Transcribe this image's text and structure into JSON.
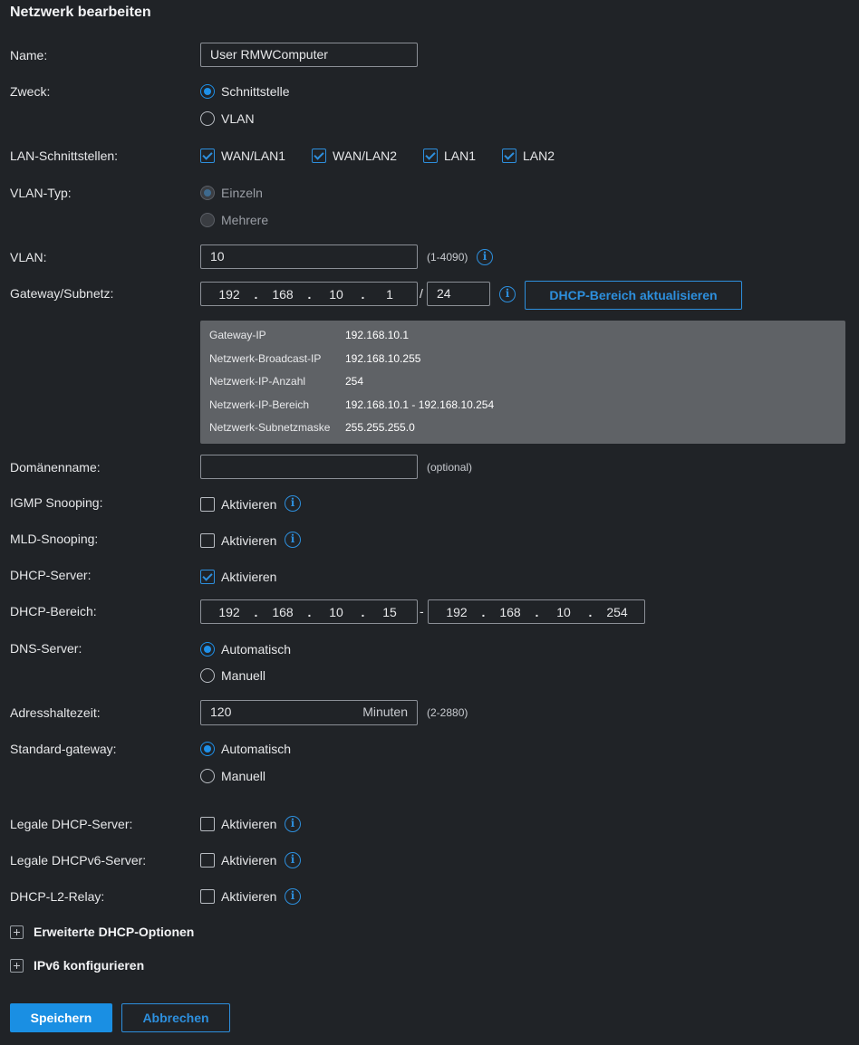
{
  "title": "Netzwerk bearbeiten",
  "name": {
    "label": "Name:",
    "value": "User RMWComputer"
  },
  "zweck": {
    "label": "Zweck:",
    "options": [
      "Schnittstelle",
      "VLAN"
    ],
    "selected": "Schnittstelle"
  },
  "lan_interfaces": {
    "label": "LAN-Schnittstellen:",
    "items": [
      {
        "label": "WAN/LAN1",
        "checked": true
      },
      {
        "label": "WAN/LAN2",
        "checked": true
      },
      {
        "label": "LAN1",
        "checked": true
      },
      {
        "label": "LAN2",
        "checked": true
      }
    ]
  },
  "vlan_type": {
    "label": "VLAN-Typ:",
    "options": [
      "Einzeln",
      "Mehrere"
    ],
    "selected": "Einzeln",
    "disabled": true
  },
  "vlan": {
    "label": "VLAN:",
    "value": "10",
    "range_hint": "(1-4090)"
  },
  "gateway": {
    "label": "Gateway/Subnetz:",
    "octets": [
      "192",
      "168",
      "10",
      "1"
    ],
    "separator": "/",
    "prefix": "24",
    "update_button": "DHCP-Bereich aktualisieren"
  },
  "network_info": [
    {
      "key": "Gateway-IP",
      "value": "192.168.10.1"
    },
    {
      "key": "Netzwerk-Broadcast-IP",
      "value": "192.168.10.255"
    },
    {
      "key": "Netzwerk-IP-Anzahl",
      "value": "254"
    },
    {
      "key": "Netzwerk-IP-Bereich",
      "value": "192.168.10.1 - 192.168.10.254"
    },
    {
      "key": "Netzwerk-Subnetzmaske",
      "value": "255.255.255.0"
    }
  ],
  "domain": {
    "label": "Domänenname:",
    "value": "",
    "hint": "(optional)"
  },
  "igmp": {
    "label": "IGMP Snooping:",
    "check_label": "Aktivieren",
    "checked": false
  },
  "mld": {
    "label": "MLD-Snooping:",
    "check_label": "Aktivieren",
    "checked": false
  },
  "dhcp_server": {
    "label": "DHCP-Server:",
    "check_label": "Aktivieren",
    "checked": true
  },
  "dhcp_range": {
    "label": "DHCP-Bereich:",
    "start": [
      "192",
      "168",
      "10",
      "15"
    ],
    "separator": "-",
    "end": [
      "192",
      "168",
      "10",
      "254"
    ]
  },
  "dns": {
    "label": "DNS-Server:",
    "options": [
      "Automatisch",
      "Manuell"
    ],
    "selected": "Automatisch"
  },
  "lease": {
    "label": "Adresshaltezeit:",
    "value": "120",
    "unit": "Minuten",
    "hint": "(2-2880)"
  },
  "default_gw": {
    "label": "Standard-gateway:",
    "options": [
      "Automatisch",
      "Manuell"
    ],
    "selected": "Automatisch"
  },
  "legal_dhcp": {
    "label": "Legale DHCP-Server:",
    "check_label": "Aktivieren",
    "checked": false
  },
  "legal_dhcpv6": {
    "label": "Legale DHCPv6-Server:",
    "check_label": "Aktivieren",
    "checked": false
  },
  "l2_relay": {
    "label": "DHCP-L2-Relay:",
    "check_label": "Aktivieren",
    "checked": false
  },
  "advanced_dhcp": {
    "label": "Erweiterte DHCP-Optionen"
  },
  "ipv6": {
    "label": "IPv6 konfigurieren"
  },
  "actions": {
    "save": "Speichern",
    "cancel": "Abbrechen"
  },
  "colors": {
    "background": "#202327",
    "accent": "#1a8fe3",
    "infobox": "#5f6266"
  }
}
